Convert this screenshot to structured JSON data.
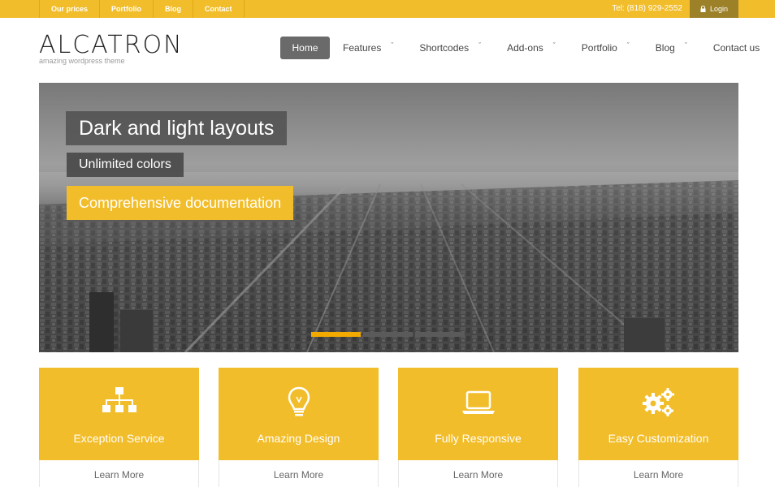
{
  "topbar": {
    "links": [
      "Our prices",
      "Portfolio",
      "Blog",
      "Contact"
    ],
    "phone": "Tel: (818) 929-2552",
    "login_label": "Login",
    "login_icon": "lock-icon"
  },
  "header": {
    "logo_title": "ALCATRON",
    "logo_tagline": "amazing wordpress theme"
  },
  "nav": {
    "items": [
      {
        "label": "Home",
        "active": true,
        "has_dropdown": false
      },
      {
        "label": "Features",
        "active": false,
        "has_dropdown": true
      },
      {
        "label": "Shortcodes",
        "active": false,
        "has_dropdown": true
      },
      {
        "label": "Add-ons",
        "active": false,
        "has_dropdown": true
      },
      {
        "label": "Portfolio",
        "active": false,
        "has_dropdown": true
      },
      {
        "label": "Blog",
        "active": false,
        "has_dropdown": true
      },
      {
        "label": "Contact us",
        "active": false,
        "has_dropdown": false
      }
    ],
    "chevron": "ˇ"
  },
  "hero": {
    "caption1": "Dark and light layouts",
    "caption2": "Unlimited colors",
    "caption3": "Comprehensive documentation",
    "slide_count": 3,
    "active_slide": 1
  },
  "features": [
    {
      "title": "Exception Service",
      "link": "Learn More",
      "icon": "sitemap-icon"
    },
    {
      "title": "Amazing Design",
      "link": "Learn More",
      "icon": "lightbulb-icon"
    },
    {
      "title": "Fully Responsive",
      "link": "Learn More",
      "icon": "laptop-icon"
    },
    {
      "title": "Easy Customization",
      "link": "Learn More",
      "icon": "gears-icon"
    }
  ],
  "colors": {
    "accent": "#f2bd2a",
    "login_bg": "#9c8128",
    "nav_active": "#6a6a6a"
  }
}
